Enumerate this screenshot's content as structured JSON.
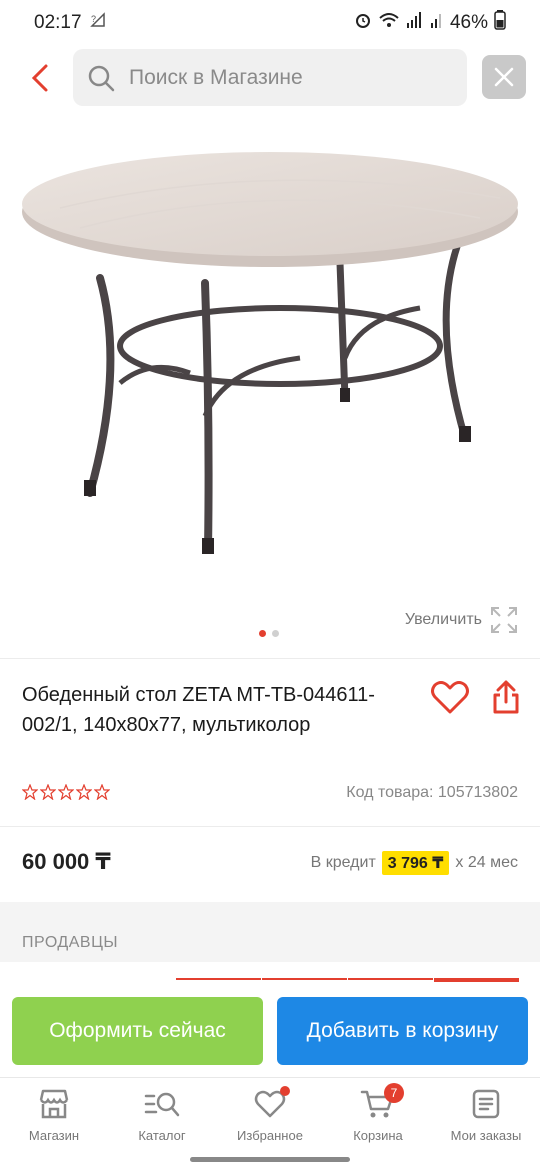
{
  "status_bar": {
    "time": "02:17",
    "battery": "46%"
  },
  "search": {
    "placeholder": "Поиск в Магазине"
  },
  "gallery": {
    "zoom_label": "Увеличить",
    "image_count": 2,
    "active_image": 1
  },
  "product": {
    "title": "Обеденный стол ZETA MT-TB-044611-002/1, 140x80x77, мультиколор",
    "rating": 0,
    "code_label": "Код товара:",
    "code_value": "105713802",
    "price": "60 000 ₸",
    "credit_prefix": "В кредит",
    "credit_monthly": "3 796 ₸",
    "credit_term": "x 24 мес"
  },
  "sellers": {
    "title": "ПРОДАВЦЫ"
  },
  "actions": {
    "checkout_label": "Оформить сейчас",
    "add_to_cart_label": "Добавить в корзину"
  },
  "nav": {
    "items": [
      {
        "label": "Магазин",
        "icon": "store-icon"
      },
      {
        "label": "Каталог",
        "icon": "catalog-search-icon"
      },
      {
        "label": "Избранное",
        "icon": "heart-icon"
      },
      {
        "label": "Корзина",
        "icon": "cart-icon",
        "badge": "7"
      },
      {
        "label": "Мои заказы",
        "icon": "orders-icon"
      }
    ]
  },
  "colors": {
    "accent_red": "#e33f2f",
    "checkout_green": "#8fd14f",
    "cart_blue": "#1e88e5",
    "credit_highlight": "#ffde00"
  }
}
